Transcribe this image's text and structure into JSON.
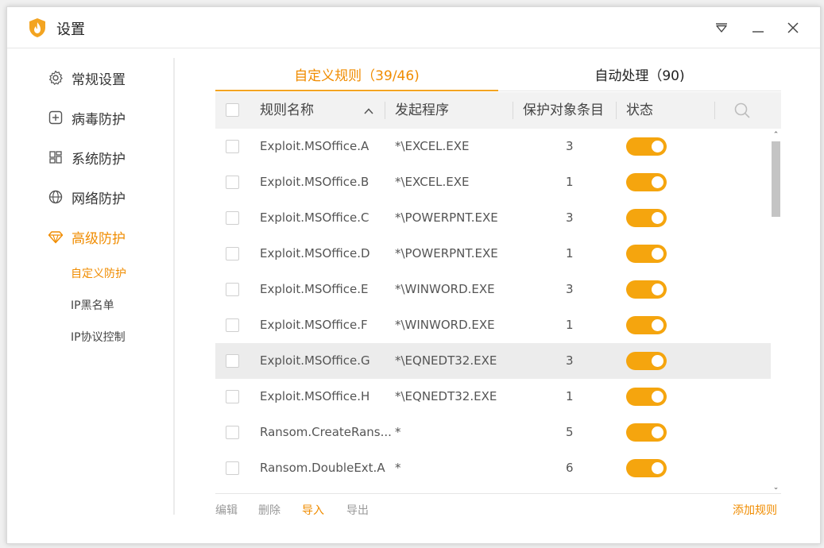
{
  "window": {
    "title": "设置"
  },
  "sidebar": {
    "items": [
      {
        "label": "常规设置",
        "icon": "gear-icon"
      },
      {
        "label": "病毒防护",
        "icon": "plus-square-icon"
      },
      {
        "label": "系统防护",
        "icon": "grid-icon"
      },
      {
        "label": "网络防护",
        "icon": "globe-icon"
      },
      {
        "label": "高级防护",
        "icon": "diamond-icon",
        "active": true
      }
    ],
    "subitems": [
      {
        "label": "自定义防护",
        "active": true
      },
      {
        "label": "IP黑名单"
      },
      {
        "label": "IP协议控制"
      }
    ]
  },
  "tabs": [
    {
      "label": "自定义规则（39/46)",
      "active": true
    },
    {
      "label": "自动处理（90)"
    }
  ],
  "table": {
    "columns": [
      "规则名称",
      "发起程序",
      "保护对象条目",
      "状态"
    ],
    "rows": [
      {
        "name": "Exploit.MSOffice.A",
        "program": "*\\EXCEL.EXE",
        "count": "3",
        "enabled": true
      },
      {
        "name": "Exploit.MSOffice.B",
        "program": "*\\EXCEL.EXE",
        "count": "1",
        "enabled": true
      },
      {
        "name": "Exploit.MSOffice.C",
        "program": "*\\POWERPNT.EXE",
        "count": "3",
        "enabled": true
      },
      {
        "name": "Exploit.MSOffice.D",
        "program": "*\\POWERPNT.EXE",
        "count": "1",
        "enabled": true
      },
      {
        "name": "Exploit.MSOffice.E",
        "program": "*\\WINWORD.EXE",
        "count": "3",
        "enabled": true
      },
      {
        "name": "Exploit.MSOffice.F",
        "program": "*\\WINWORD.EXE",
        "count": "1",
        "enabled": true
      },
      {
        "name": "Exploit.MSOffice.G",
        "program": "*\\EQNEDT32.EXE",
        "count": "3",
        "enabled": true,
        "highlighted": true
      },
      {
        "name": "Exploit.MSOffice.H",
        "program": "*\\EQNEDT32.EXE",
        "count": "1",
        "enabled": true
      },
      {
        "name": "Ransom.CreateRans...",
        "program": "*",
        "count": "5",
        "enabled": true
      },
      {
        "name": "Ransom.DoubleExt.A",
        "program": "*",
        "count": "6",
        "enabled": true
      }
    ]
  },
  "footer": {
    "edit": "编辑",
    "delete": "删除",
    "import": "导入",
    "export": "导出",
    "add_rule": "添加规则"
  },
  "colors": {
    "accent": "#f08c00",
    "toggle_on": "#f5a50e"
  }
}
